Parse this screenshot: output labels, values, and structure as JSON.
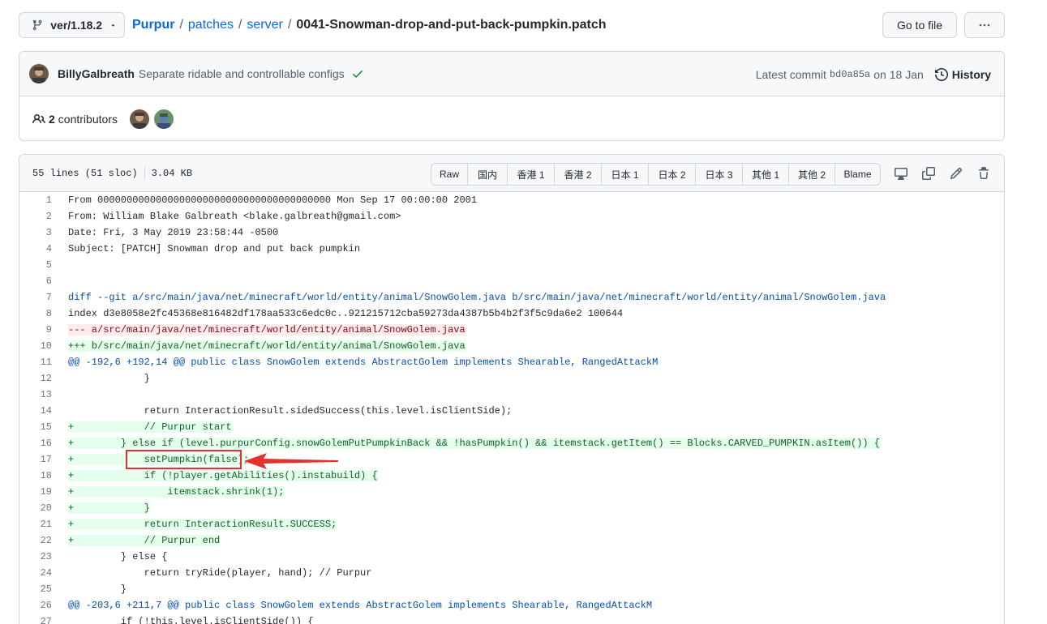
{
  "toolbar": {
    "branch": "ver/1.18.2",
    "breadcrumb": {
      "repo": "Purpur",
      "path1": "patches",
      "path2": "server",
      "file": "0041-Snowman-drop-and-put-back-pumpkin.patch"
    },
    "goto_file": "Go to file",
    "more": "···"
  },
  "commit": {
    "author": "BillyGalbreath",
    "message": "Separate ridable and controllable configs",
    "latest_label": "Latest commit",
    "sha": "bd0a85a",
    "date": "on 18 Jan",
    "history": "History"
  },
  "contributors": {
    "count": "2",
    "label": "contributors"
  },
  "file": {
    "lines": "55 lines (51 sloc)",
    "size": "3.04 KB",
    "buttons": [
      "Raw",
      "国内",
      "香港 1",
      "香港 2",
      "日本 1",
      "日本 2",
      "日本 3",
      "其他 1",
      "其他 2",
      "Blame"
    ]
  },
  "code_lines": [
    {
      "n": "1",
      "t": "From 0000000000000000000000000000000000000000 Mon Sep 17 00:00:00 2001",
      "k": "plain"
    },
    {
      "n": "2",
      "t": "From: William Blake Galbreath <blake.galbreath@gmail.com>",
      "k": "plain"
    },
    {
      "n": "3",
      "t": "Date: Fri, 3 May 2019 23:58:44 -0500",
      "k": "plain"
    },
    {
      "n": "4",
      "t": "Subject: [PATCH] Snowman drop and put back pumpkin",
      "k": "plain"
    },
    {
      "n": "5",
      "t": "",
      "k": "plain"
    },
    {
      "n": "6",
      "t": "",
      "k": "plain"
    },
    {
      "n": "7",
      "t": "diff --git a/src/main/java/net/minecraft/world/entity/animal/SnowGolem.java b/src/main/java/net/minecraft/world/entity/animal/SnowGolem.java",
      "k": "diff"
    },
    {
      "n": "8",
      "t": "index d3e8058e2fc45368e816482df178aa533c6edc0c..921215712cba59273da4387b5b4b2f3f5c9da6e2 100644",
      "k": "plain"
    },
    {
      "n": "9",
      "t": "--- a/src/main/java/net/minecraft/world/entity/animal/SnowGolem.java",
      "k": "del"
    },
    {
      "n": "10",
      "t": "+++ b/src/main/java/net/minecraft/world/entity/animal/SnowGolem.java",
      "k": "add"
    },
    {
      "n": "11",
      "t": "@@ -192,6 +192,14 @@ public class SnowGolem extends AbstractGolem implements Shearable, RangedAttackM",
      "k": "hunk"
    },
    {
      "n": "12",
      "t": "             }",
      "k": "plain"
    },
    {
      "n": "13",
      "t": "",
      "k": "plain"
    },
    {
      "n": "14",
      "t": "             return InteractionResult.sidedSuccess(this.level.isClientSide);",
      "k": "plain"
    },
    {
      "n": "15",
      "t": "+            // Purpur start",
      "k": "add"
    },
    {
      "n": "16",
      "t": "+        } else if (level.purpurConfig.snowGolemPutPumpkinBack && !hasPumpkin() && itemstack.getItem() == Blocks.CARVED_PUMPKIN.asItem()) {",
      "k": "add"
    },
    {
      "n": "17",
      "t": "+            setPumpkin(false);",
      "k": "add"
    },
    {
      "n": "18",
      "t": "+            if (!player.getAbilities().instabuild) {",
      "k": "add"
    },
    {
      "n": "19",
      "t": "+                itemstack.shrink(1);",
      "k": "add"
    },
    {
      "n": "20",
      "t": "+            }",
      "k": "add"
    },
    {
      "n": "21",
      "t": "+            return InteractionResult.SUCCESS;",
      "k": "add"
    },
    {
      "n": "22",
      "t": "+            // Purpur end",
      "k": "add"
    },
    {
      "n": "23",
      "t": "         } else {",
      "k": "plain"
    },
    {
      "n": "24",
      "t": "             return tryRide(player, hand); // Purpur",
      "k": "plain"
    },
    {
      "n": "25",
      "t": "         }",
      "k": "plain"
    },
    {
      "n": "26",
      "t": "@@ -203,6 +211,7 @@ public class SnowGolem extends AbstractGolem implements Shearable, RangedAttackM",
      "k": "hunk"
    },
    {
      "n": "27",
      "t": "         if (!this.level.isClientSide()) {",
      "k": "plain"
    }
  ],
  "annotation": {
    "color": "#e5312b",
    "target_line": "17"
  }
}
